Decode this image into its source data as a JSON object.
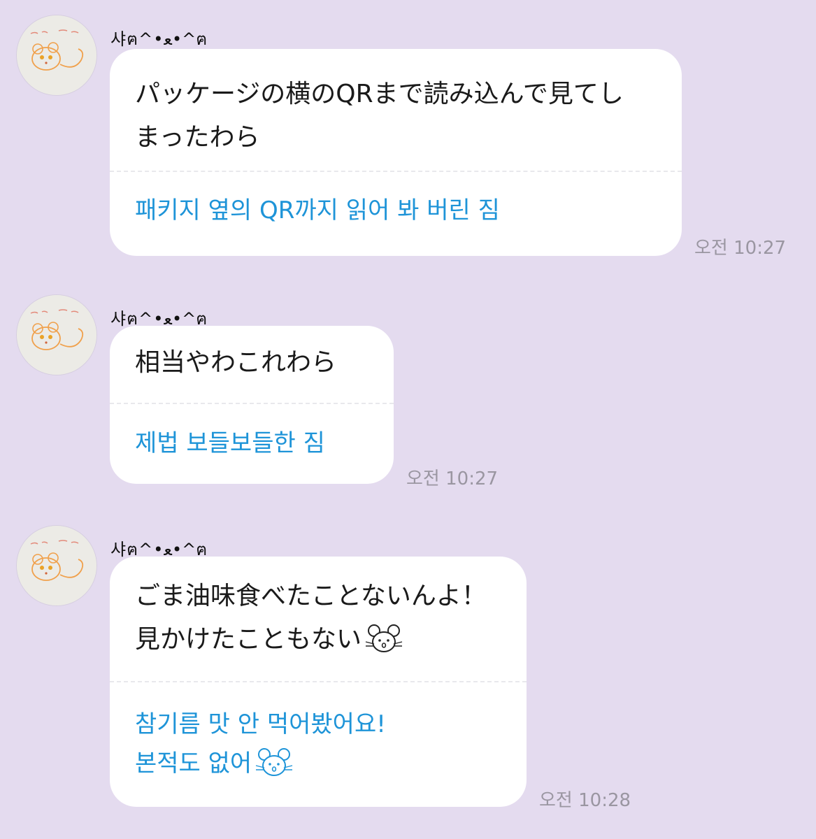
{
  "messages": [
    {
      "sender": "샤ฅ^•ﻌ•^ฅ",
      "original": "パッケージの横のQRまで読み込んで見てし\nまったわら",
      "translation": "패키지 옆의 QR까지 읽어 봐 버린 짐",
      "time": "오전 10:27",
      "emoji": ""
    },
    {
      "sender": "샤ฅ^•ﻌ•^ฅ",
      "original": "相当やわこれわら",
      "translation": "제법 보들보들한 짐",
      "time": "오전 10:27",
      "emoji": ""
    },
    {
      "sender": "샤ฅ^•ﻌ•^ฅ",
      "original": "ごま油味食べたことないんよ！\n見かけたこともない",
      "translation": "참기름 맛 안 먹어봤어요!\n본적도 없어",
      "time": "오전 10:28",
      "emoji": "mouse-face-icon"
    }
  ],
  "colors": {
    "background": "#e4dbef",
    "bubble": "#ffffff",
    "translation_text": "#1e94d8",
    "timestamp": "#9a96a1"
  }
}
